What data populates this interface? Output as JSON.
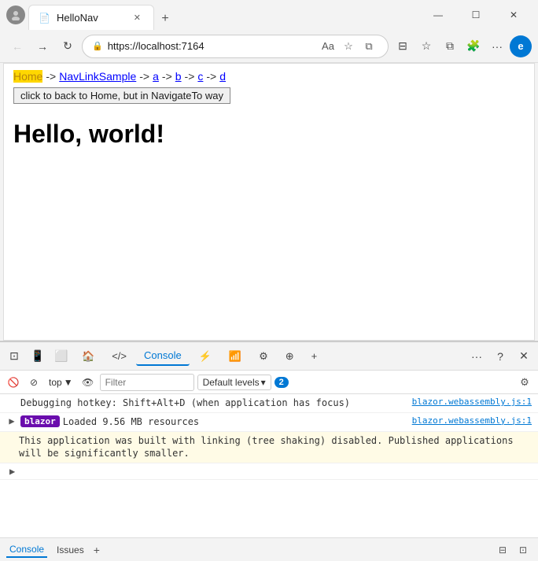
{
  "window": {
    "title": "HelloNav",
    "url": "https://localhost:7164",
    "favicon": "📄"
  },
  "titlebar": {
    "tab_label": "HelloNav",
    "new_tab_icon": "+",
    "minimize": "—",
    "maximize": "☐",
    "close": "✕",
    "profile_initial": ""
  },
  "addressbar": {
    "back_icon": "←",
    "forward_icon": "→",
    "refresh_icon": "↻",
    "lock_icon": "🔒",
    "url": "https://localhost:7164",
    "read_mode_icon": "Aa",
    "favorites_icon": "☆",
    "split_icon": "⧉",
    "collections_icon": "☆",
    "extensions_icon": "🧩",
    "more_icon": "...",
    "edge_icon": "e"
  },
  "page": {
    "breadcrumb": {
      "home": "Home",
      "separator1": "->",
      "navlink": "NavLinkSample",
      "sep2": "->",
      "a_link": "a",
      "sep3": "->",
      "b_link": "b",
      "sep4": "->",
      "c_link": "c",
      "sep5": "->",
      "d_link": "d"
    },
    "nav_button": "click to back to Home, but in NavigateTo way",
    "hello": "Hello, world!"
  },
  "devtools": {
    "tabs": [
      {
        "label": "⚙",
        "id": "devtools-icon"
      },
      {
        "label": "📋",
        "id": "copy-icon"
      },
      {
        "label": "⬜",
        "id": "dock-icon"
      },
      {
        "label": "🏠",
        "id": "home"
      },
      {
        "label": "</>",
        "id": "sources"
      },
      {
        "label": "Console",
        "id": "console",
        "active": true
      },
      {
        "label": "⚡",
        "id": "performance"
      },
      {
        "label": "📶",
        "id": "network"
      },
      {
        "label": "⚙",
        "id": "settings2"
      },
      {
        "label": "⊕",
        "id": "lighthouse"
      },
      {
        "label": "+",
        "id": "more-tabs"
      }
    ],
    "right_icons": [
      "...",
      "?",
      "✕"
    ],
    "console": {
      "filter_placeholder": "Filter",
      "default_levels": "Default levels",
      "badge_count": "2",
      "context": "top",
      "messages": [
        {
          "type": "info",
          "text": "Debugging hotkey: Shift+Alt+D (when application has focus)",
          "source": "blazor.webassembly.js:1",
          "expandable": false
        },
        {
          "type": "info",
          "badge": "blazor",
          "text": "Loaded 9.56 MB resources",
          "source": "blazor.webassembly.js:1",
          "expandable": true,
          "warning_text": "This application was built with linking (tree shaking) disabled. Published applications will be significantly smaller."
        }
      ]
    }
  },
  "bottombar": {
    "tabs": [
      "Console",
      "Issues"
    ],
    "active_tab": "Console",
    "add_icon": "+",
    "right_icons": [
      "⊟",
      "⊡"
    ]
  }
}
